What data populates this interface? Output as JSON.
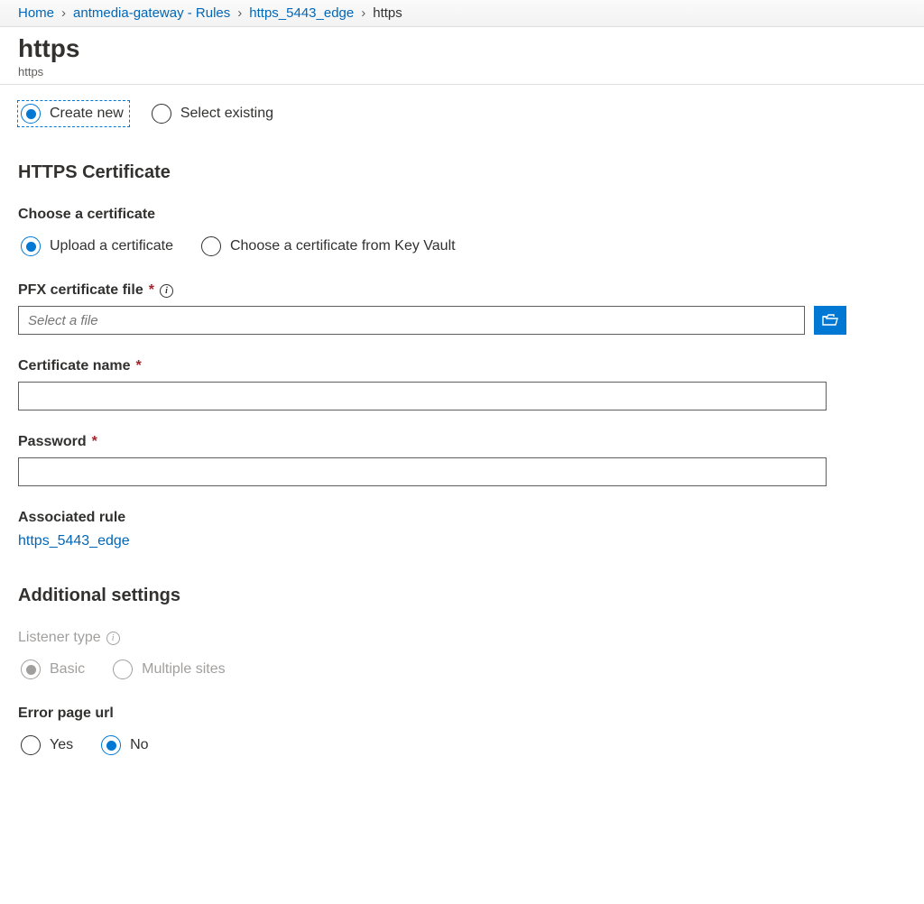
{
  "breadcrumb": {
    "items": [
      {
        "label": "Home",
        "link": true
      },
      {
        "label": "antmedia-gateway - Rules",
        "link": true
      },
      {
        "label": "https_5443_edge",
        "link": true
      },
      {
        "label": "https",
        "link": false
      }
    ]
  },
  "header": {
    "title": "https",
    "subtitle": "https"
  },
  "mode_radio": {
    "create_new": "Create new",
    "select_existing": "Select existing",
    "selected": "create_new"
  },
  "cert_section": {
    "title": "HTTPS Certificate",
    "choose_label": "Choose a certificate",
    "upload": "Upload a certificate",
    "keyvault": "Choose a certificate from Key Vault",
    "selected": "upload"
  },
  "pfx": {
    "label": "PFX certificate file",
    "required": true,
    "has_info": true,
    "placeholder": "Select a file",
    "value": ""
  },
  "cert_name": {
    "label": "Certificate name",
    "required": true,
    "value": ""
  },
  "password": {
    "label": "Password",
    "required": true,
    "value": ""
  },
  "associated_rule": {
    "label": "Associated rule",
    "link_text": "https_5443_edge"
  },
  "additional": {
    "title": "Additional settings",
    "listener_type_label": "Listener type",
    "basic": "Basic",
    "multiple": "Multiple sites",
    "selected": "basic",
    "disabled": true
  },
  "error_page": {
    "label": "Error page url",
    "yes": "Yes",
    "no": "No",
    "selected": "no"
  }
}
